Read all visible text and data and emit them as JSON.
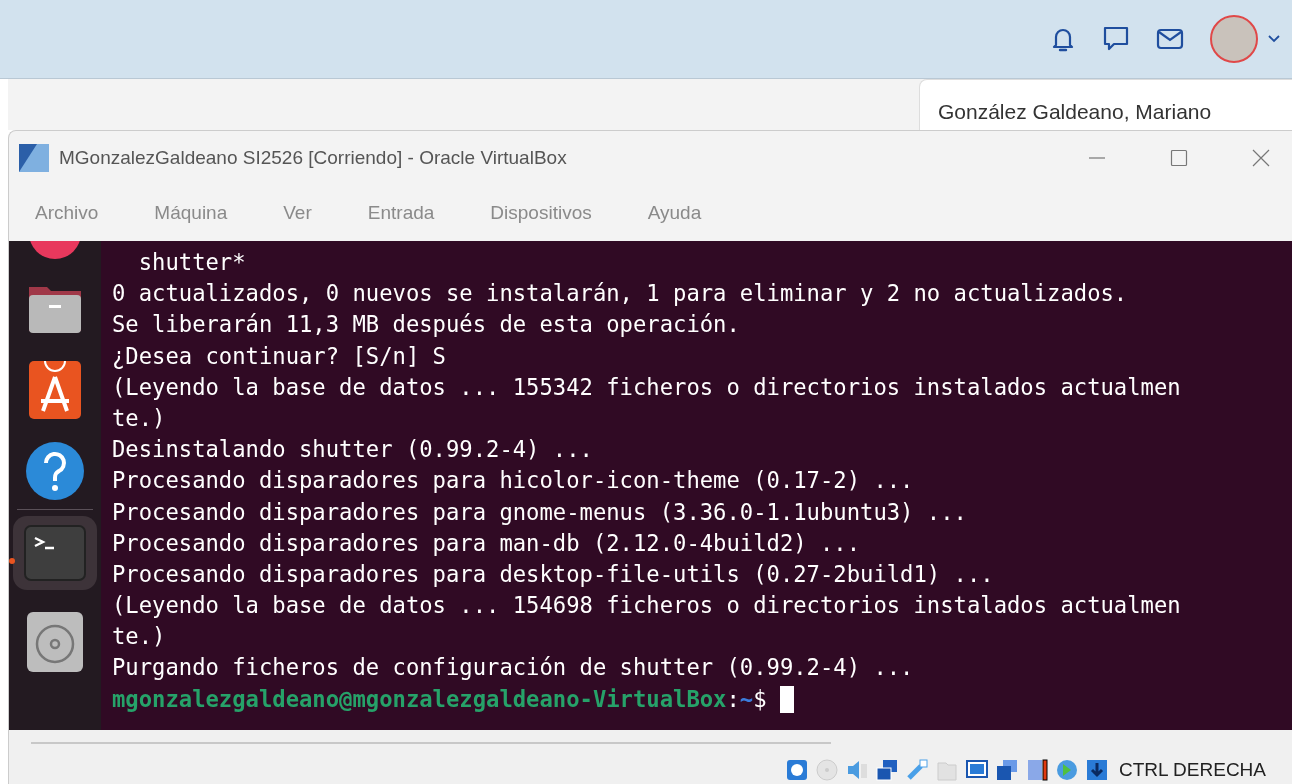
{
  "header": {
    "user_name": "González Galdeano, Mariano"
  },
  "window": {
    "title": "MGonzalezGaldeano SI2526 [Corriendo] - Oracle VirtualBox",
    "menu": [
      "Archivo",
      "Máquina",
      "Ver",
      "Entrada",
      "Dispositivos",
      "Ayuda"
    ],
    "dock": [
      {
        "kind": "browser",
        "selected": false
      },
      {
        "kind": "files",
        "selected": false
      },
      {
        "kind": "store",
        "selected": false
      },
      {
        "kind": "help",
        "selected": false
      },
      {
        "kind": "terminal",
        "selected": true
      },
      {
        "kind": "disc",
        "selected": false
      }
    ],
    "terminal": {
      "lines": [
        {
          "kind": "output",
          "text": "  shutter*"
        },
        {
          "kind": "output",
          "text": "0 actualizados, 0 nuevos se instalarán, 1 para eliminar y 2 no actualizados."
        },
        {
          "kind": "output",
          "text": "Se liberarán 11,3 MB después de esta operación."
        },
        {
          "kind": "output",
          "text": "¿Desea continuar? [S/n] S"
        },
        {
          "kind": "output",
          "text": "(Leyendo la base de datos ... 155342 ficheros o directorios instalados actualmen"
        },
        {
          "kind": "output",
          "text": "te.)"
        },
        {
          "kind": "output",
          "text": "Desinstalando shutter (0.99.2-4) ..."
        },
        {
          "kind": "output",
          "text": "Procesando disparadores para hicolor-icon-theme (0.17-2) ..."
        },
        {
          "kind": "output",
          "text": "Procesando disparadores para gnome-menus (3.36.0-1.1ubuntu3) ..."
        },
        {
          "kind": "output",
          "text": "Procesando disparadores para man-db (2.12.0-4build2) ..."
        },
        {
          "kind": "output",
          "text": "Procesando disparadores para desktop-file-utils (0.27-2build1) ..."
        },
        {
          "kind": "output",
          "text": "(Leyendo la base de datos ... 154698 ficheros o directorios instalados actualmen"
        },
        {
          "kind": "output",
          "text": "te.)"
        },
        {
          "kind": "output",
          "text": "Purgando ficheros de configuración de shutter (0.99.2-4) ..."
        },
        {
          "kind": "prompt",
          "user_host": "mgonzalezgaldeano@mgonzalezgaldeano-VirtualBox",
          "sep": ":",
          "path": "~",
          "symbol": "$"
        }
      ]
    },
    "status_bar": {
      "host_key": "CTRL DERECHA"
    }
  }
}
